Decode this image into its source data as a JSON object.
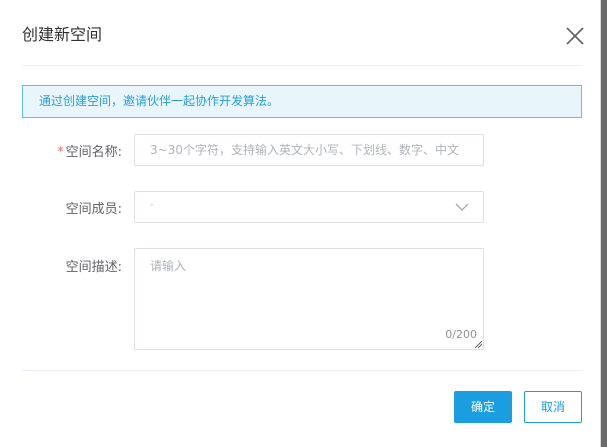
{
  "dialog": {
    "title": "创建新空间",
    "banner_text": "通过创建空间，邀请伙伴一起协作开发算法。"
  },
  "form": {
    "name": {
      "required_mark": "*",
      "label": "空间名称:",
      "value": "",
      "placeholder": "3~30个字符，支持输入英文大小写、下划线、数字、中文"
    },
    "members": {
      "label": "空间成员:",
      "selected_value": "·"
    },
    "description": {
      "label": "空间描述:",
      "value": "",
      "placeholder": "请输入",
      "word_count": "0/200"
    }
  },
  "footer": {
    "confirm_label": "确定",
    "cancel_label": "取消"
  },
  "icons": {
    "close": "close-icon",
    "dropdown": "chevron-down-icon",
    "resize": "resize-handle-icon"
  },
  "colors": {
    "primary": "#1a9ee0",
    "banner_bg": "#e8f6fc",
    "banner_border": "#5ec1ea",
    "required": "#f56c6c"
  }
}
